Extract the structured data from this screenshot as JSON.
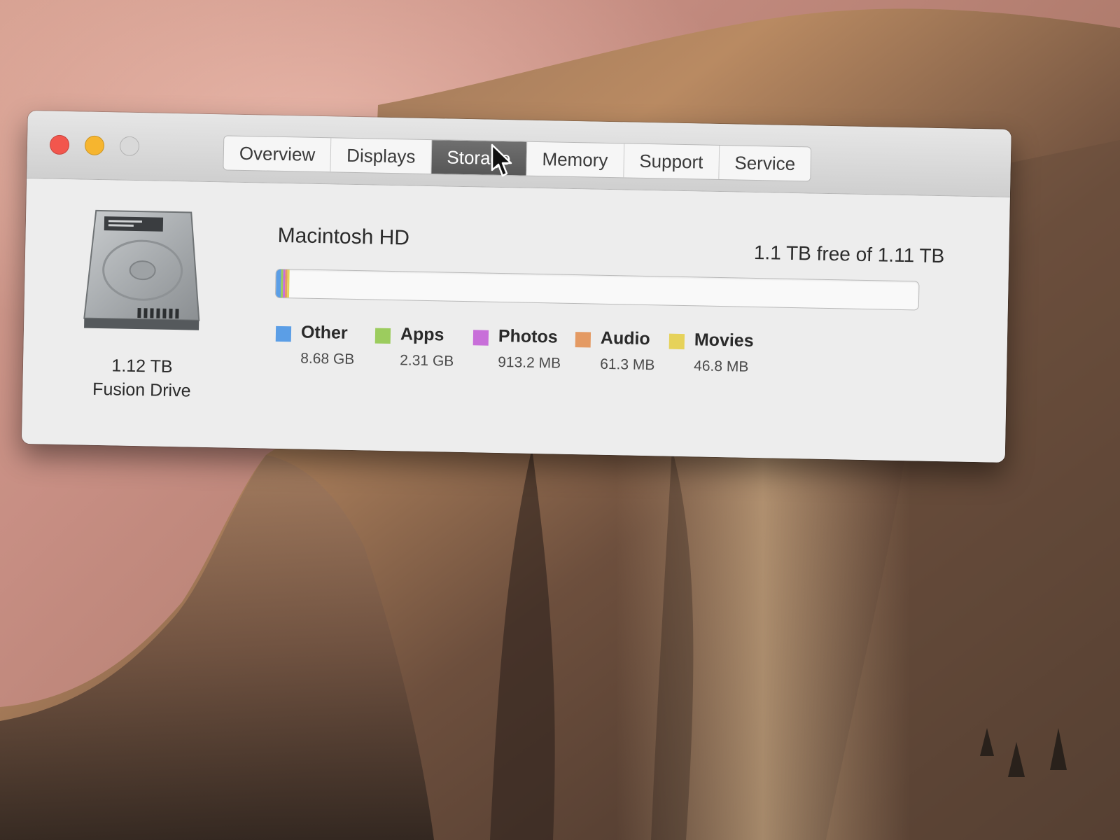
{
  "window": {
    "tabs": [
      {
        "label": "Overview",
        "active": false
      },
      {
        "label": "Displays",
        "active": false
      },
      {
        "label": "Storage",
        "active": true
      },
      {
        "label": "Memory",
        "active": false
      },
      {
        "label": "Support",
        "active": false
      },
      {
        "label": "Service",
        "active": false
      }
    ],
    "traffic_lights": {
      "close_color": "#f2564d",
      "minimize_color": "#f6b52f",
      "zoom_color": "#d9d9d9"
    }
  },
  "drive": {
    "icon": "hard-drive-icon",
    "capacity": "1.12 TB",
    "type": "Fusion Drive"
  },
  "volume": {
    "name": "Macintosh HD",
    "free_text": "1.1 TB free of 1.11 TB",
    "used_fraction": 0.011
  },
  "categories": [
    {
      "name": "Other",
      "size": "8.68 GB",
      "color": "#5b9ee6",
      "fraction": 0.0078
    },
    {
      "name": "Apps",
      "size": "2.31 GB",
      "color": "#9ccc5e",
      "fraction": 0.0021
    },
    {
      "name": "Photos",
      "size": "913.2 MB",
      "color": "#c86fd9",
      "fraction": 0.0009
    },
    {
      "name": "Audio",
      "size": "61.3 MB",
      "color": "#e49a63",
      "fraction": 0.0003
    },
    {
      "name": "Movies",
      "size": "46.8 MB",
      "color": "#e6d25a",
      "fraction": 0.0003
    }
  ]
}
